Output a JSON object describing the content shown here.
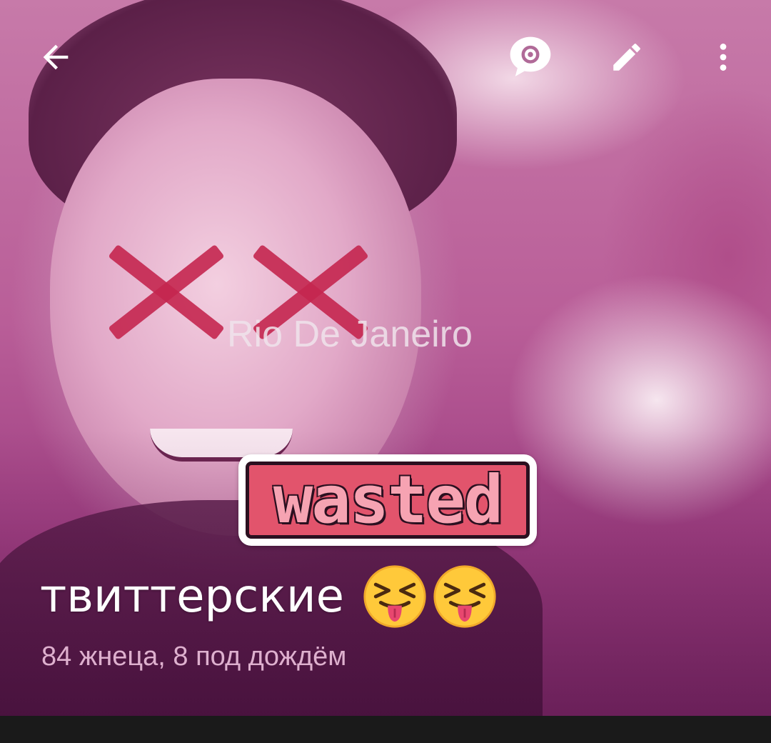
{
  "toolbar": {
    "back_icon": "arrow-left-icon",
    "settings_icon": "chat-settings-icon",
    "edit_icon": "pencil-icon",
    "more_icon": "more-vertical-icon"
  },
  "photo": {
    "overlay_text": "Rio De Janeiro",
    "sticker_text": "wasted"
  },
  "chat": {
    "title": "твиттерские",
    "title_emojis": [
      "squinting-tongue-emoji",
      "squinting-tongue-emoji"
    ],
    "subtitle": "84 жнеца, 8 под дождём"
  },
  "colors": {
    "accent_pink": "#e2546c",
    "x_mark": "#c4264f",
    "subtitle": "#e6b9d6",
    "bottom_bar": "#1a1a1a"
  }
}
